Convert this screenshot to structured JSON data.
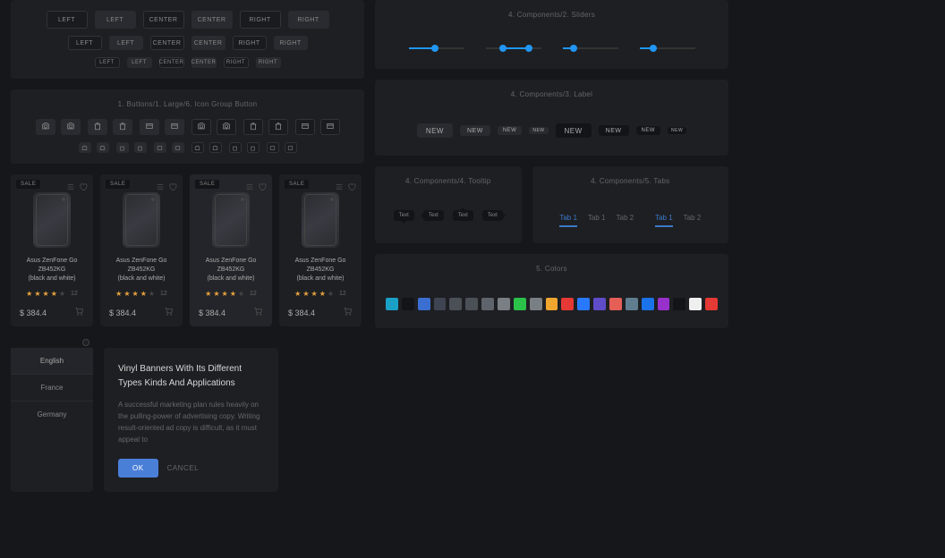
{
  "buttons_panel": {
    "rows": [
      {
        "size": "lg",
        "items": [
          "LEFT",
          "LEFT",
          "CENTER",
          "CENTER",
          "RIGHT",
          "RIGHT"
        ]
      },
      {
        "size": "md",
        "items": [
          "LEFT",
          "LEFT",
          "CENTER",
          "CENTER",
          "RIGHT",
          "RIGHT"
        ]
      },
      {
        "size": "sm",
        "items": [
          "LEFT",
          "LEFT",
          "CENTER",
          "CENTER",
          "RIGHT",
          "RIGHT"
        ]
      }
    ]
  },
  "icon_buttons_panel": {
    "title": "1. Buttons/1. Large/6. Icon Group Button"
  },
  "sliders_panel": {
    "title": "4. Components/2. Sliders",
    "slider1": {
      "value": 48
    },
    "slider2": {
      "low": 32,
      "high": 78
    },
    "slider3": {
      "value": 20
    },
    "slider4": {
      "value": 25
    }
  },
  "label_panel": {
    "title": "4. Components/3. Label",
    "text": "NEW"
  },
  "tooltip_panel": {
    "title": "4. Components/4. Tooltip",
    "text": "Text"
  },
  "tabs_panel": {
    "title": "4. Components/5. Tabs",
    "set1": [
      "Tab 1",
      "Tab 1",
      "Tab 2"
    ],
    "set2": [
      "Tab 1",
      "Tab 2"
    ]
  },
  "colors_panel": {
    "title": "5. Colors",
    "swatches": [
      "#1aa0c7",
      "#131418",
      "#3a6fd1",
      "#3f4452",
      "#4b5057",
      "#4b5057",
      "#5f646c",
      "#7a7f86",
      "#2bc24a",
      "#7a7f86",
      "#f0a62e",
      "#e53935",
      "#2979ff",
      "#5e4dc9",
      "#e55f57",
      "#5f7d8f",
      "#1a73e8",
      "#9831cc",
      "#131418",
      "#efefef",
      "#e53935"
    ]
  },
  "product": {
    "sale": "SALE",
    "name_l1": "Asus ZenFone Go ZB452KG",
    "name_l2": "(black and white)",
    "rating_count": "12",
    "price": "$ 384.4"
  },
  "languages": {
    "items": [
      "English",
      "France",
      "Germany"
    ]
  },
  "modal": {
    "title": "Vinyl Banners With Its Different Types Kinds And Applications",
    "body": "A successful marketing plan rules heavily on the pulling-power of advertising copy. Writing result-oriented ad copy is difficult, as it must appeal to",
    "ok": "OK",
    "cancel": "CANCEL"
  }
}
